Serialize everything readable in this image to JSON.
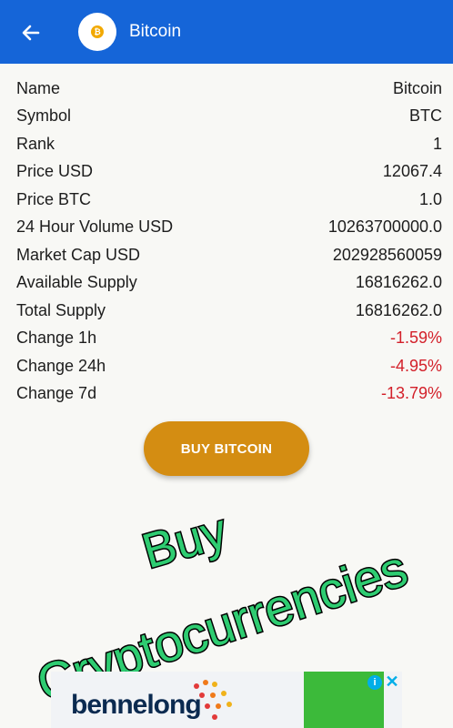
{
  "appbar": {
    "title": "Bitcoin",
    "back_icon": "arrow-left-icon",
    "coin_symbol": "₿"
  },
  "details": [
    {
      "label": "Name",
      "value": "Bitcoin",
      "negative": false
    },
    {
      "label": "Symbol",
      "value": "BTC",
      "negative": false
    },
    {
      "label": "Rank",
      "value": "1",
      "negative": false
    },
    {
      "label": "Price USD",
      "value": "12067.4",
      "negative": false
    },
    {
      "label": "Price BTC",
      "value": "1.0",
      "negative": false
    },
    {
      "label": "24 Hour Volume USD",
      "value": "10263700000.0",
      "negative": false
    },
    {
      "label": "Market Cap USD",
      "value": "202928560059",
      "negative": false
    },
    {
      "label": "Available Supply",
      "value": "16816262.0",
      "negative": false
    },
    {
      "label": "Total Supply",
      "value": "16816262.0",
      "negative": false
    },
    {
      "label": "Change 1h",
      "value": "-1.59%",
      "negative": true
    },
    {
      "label": "Change 24h",
      "value": "-4.95%",
      "negative": true
    },
    {
      "label": "Change 7d",
      "value": "-13.79%",
      "negative": true
    }
  ],
  "buy_button": {
    "label": "BUY BITCOIN"
  },
  "overlay": {
    "line1": "Buy",
    "line2": "Cryptocurrencies"
  },
  "ad": {
    "brand": "bennelong",
    "info_icon": "i",
    "close_icon": "✕"
  },
  "colors": {
    "appbar": "#1565d8",
    "button": "#d48d12",
    "negative": "#d3202a",
    "overlay_text": "#2ecc71"
  }
}
